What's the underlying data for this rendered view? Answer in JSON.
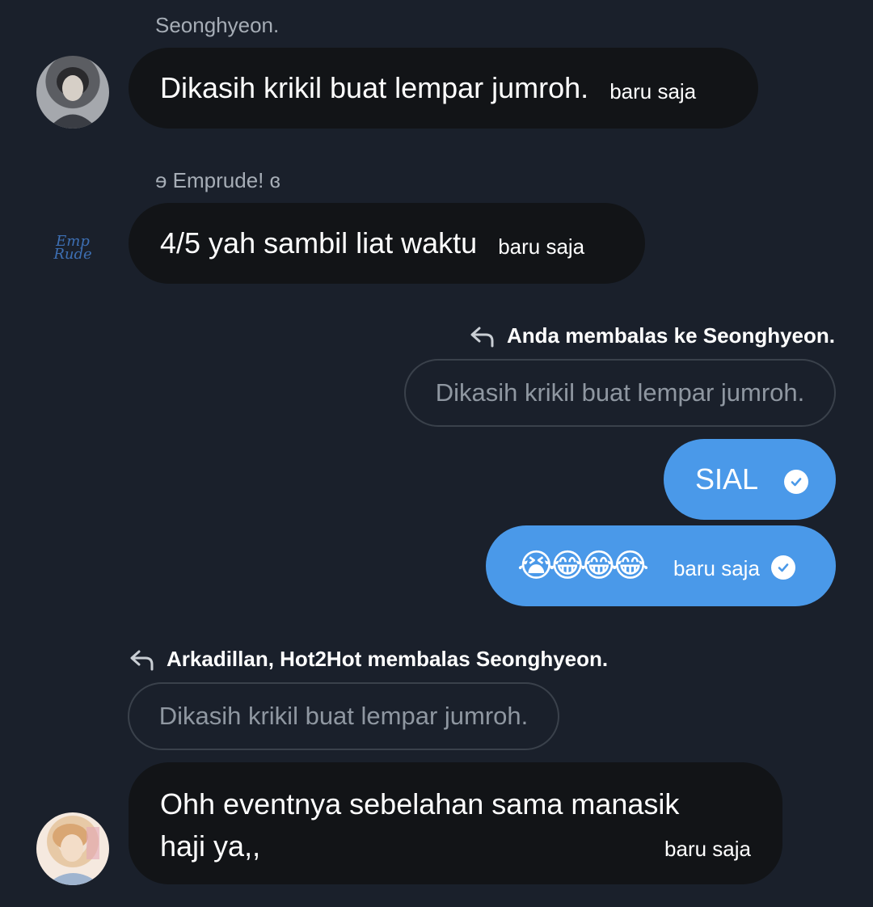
{
  "messages": [
    {
      "sender": "Seonghyeon.",
      "text": "Dikasih krikil buat lempar jumroh.",
      "time": "baru saja"
    },
    {
      "sender": "ɘ Emprude! ɞ",
      "text": "4/5 yah sambil liat waktu",
      "time": "baru saja",
      "avatar_text": {
        "line1": "Emp",
        "line2": "Rude"
      }
    },
    {
      "reply_context": "Anda membalas ke Seonghyeon.",
      "quote": "Dikasih krikil buat lempar jumroh.",
      "text": "SIAL"
    },
    {
      "text": "😭😂😂😂",
      "time": "baru saja"
    },
    {
      "reply_context": "Arkadillan, Hot2Hot membalas Seonghyeon.",
      "quote": "Dikasih krikil buat lempar jumroh.",
      "text_line1": "Ohh eventnya sebelahan sama manasik",
      "text_line2": "haji ya,,",
      "time": "baru saja"
    }
  ],
  "icons": {
    "reply": "reply-arrow-icon",
    "sent": "check-circle-icon"
  },
  "colors": {
    "background": "#1a202b",
    "incoming_bubble": "#121417",
    "outgoing_bubble": "#4a99e9",
    "quote_text": "#8f97a1"
  }
}
